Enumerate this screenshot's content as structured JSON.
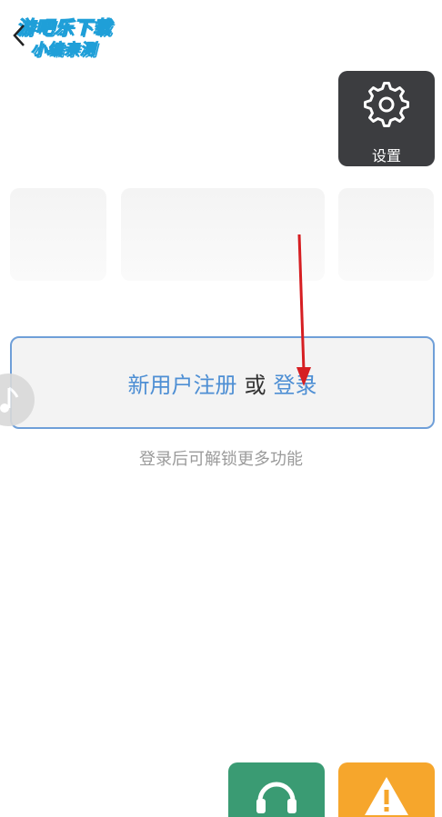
{
  "watermark": {
    "line1": "游吧乐下载",
    "line2": "小编亲测"
  },
  "settings": {
    "label": "设置",
    "icon": "gear-icon"
  },
  "login": {
    "register_label": "新用户注册",
    "or_label": "或",
    "login_label": "登录"
  },
  "hint": "登录后可解锁更多功能",
  "colors": {
    "link": "#4e8fd4",
    "settings_bg": "#3c3d40",
    "service_bg": "#3a9b73",
    "warning_bg": "#f6a62c",
    "arrow": "#d61e22"
  },
  "bottom_buttons": [
    {
      "name": "customer-service",
      "icon": "headset-icon"
    },
    {
      "name": "feedback",
      "icon": "warning-icon"
    }
  ]
}
